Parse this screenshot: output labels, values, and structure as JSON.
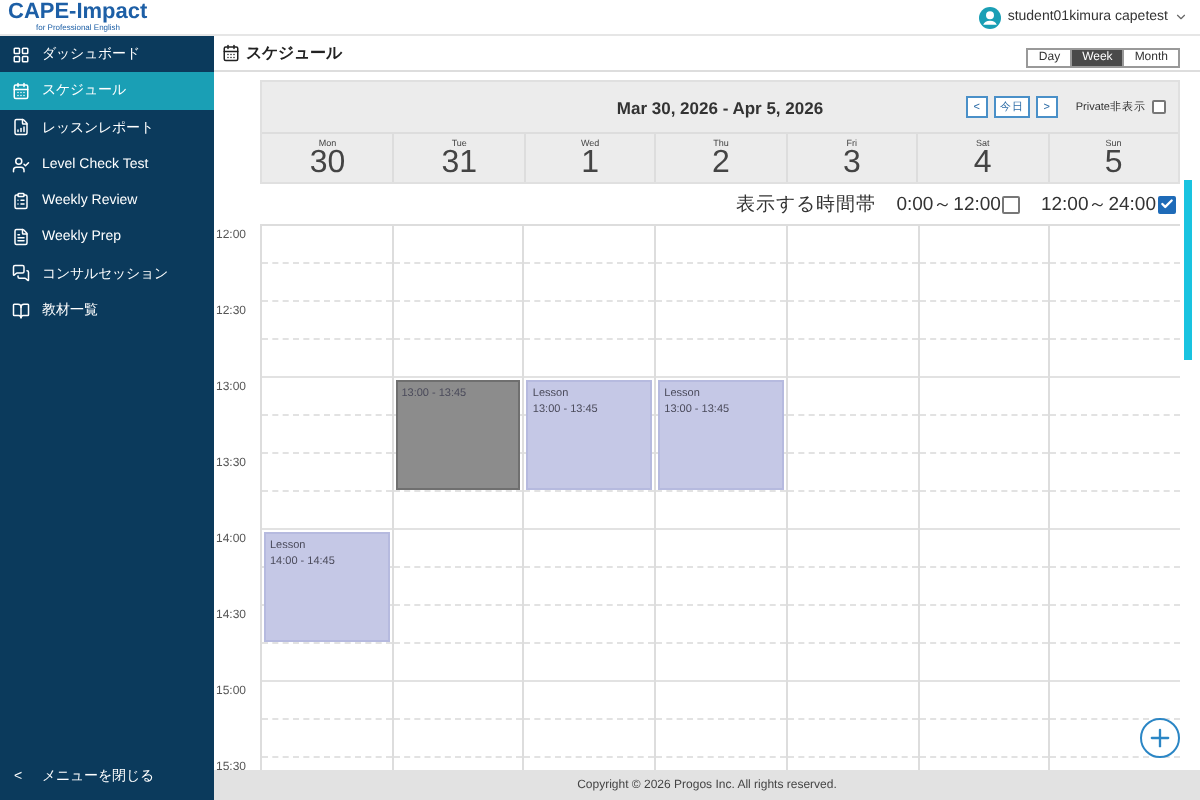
{
  "app": {
    "logo": "CAPE-Impact",
    "tagline": "for Professional English"
  },
  "user": {
    "name": "student01kimura capetest"
  },
  "sidebar": {
    "items": [
      {
        "label": "ダッシュボード",
        "kind": "dashboard",
        "selected": false
      },
      {
        "label": "スケジュール",
        "kind": "schedule",
        "selected": true
      },
      {
        "label": "レッスンレポート",
        "kind": "report",
        "selected": false
      },
      {
        "label": "Level Check Test",
        "kind": "test",
        "selected": false
      },
      {
        "label": "Weekly Review",
        "kind": "review",
        "selected": false
      },
      {
        "label": "Weekly Prep",
        "kind": "prep",
        "selected": false
      },
      {
        "label": "コンサルセッション",
        "kind": "consult",
        "selected": false
      },
      {
        "label": "教材一覧",
        "kind": "materials",
        "selected": false
      }
    ],
    "collapse": {
      "icon": "<",
      "label": "メニューを閉じる"
    }
  },
  "page": {
    "title": "スケジュール"
  },
  "views": [
    {
      "label": "Day",
      "selected": false
    },
    {
      "label": "Week",
      "selected": true
    },
    {
      "label": "Month",
      "selected": false
    }
  ],
  "calendar": {
    "range": "Mar 30, 2026 - Apr 5, 2026",
    "nav": {
      "prev": "<",
      "today": "今日",
      "next": ">"
    },
    "private": {
      "label": "Private非表示",
      "checked": false
    },
    "days": [
      {
        "dow": "Mon",
        "date": "30",
        "events": [
          {
            "kind": "lesson",
            "title": "Lesson",
            "time": "14:00 - 14:45"
          }
        ]
      },
      {
        "dow": "Tue",
        "date": "31",
        "events": [
          {
            "kind": "blocked",
            "time": "13:00 - 13:45"
          }
        ]
      },
      {
        "dow": "Wed",
        "date": "1",
        "events": [
          {
            "kind": "lesson",
            "title": "Lesson",
            "time": "13:00 - 13:45"
          }
        ]
      },
      {
        "dow": "Thu",
        "date": "2",
        "events": [
          {
            "kind": "lesson",
            "title": "Lesson",
            "time": "13:00 - 13:45"
          }
        ]
      },
      {
        "dow": "Fri",
        "date": "3"
      },
      {
        "dow": "Sat",
        "date": "4"
      },
      {
        "dow": "Sun",
        "date": "5"
      }
    ],
    "time_filter": {
      "label": "表示する時間帯",
      "options": [
        {
          "label": "0:00～12:00",
          "checked": false
        },
        {
          "label": "12:00～24:00",
          "checked": true
        }
      ]
    },
    "time_labels": [
      "12:00",
      "12:30",
      "13:00",
      "13:30",
      "14:00",
      "14:30",
      "15:00",
      "15:30"
    ]
  },
  "footer": {
    "text": "Copyright © 2026 Progos Inc. All rights reserved."
  }
}
